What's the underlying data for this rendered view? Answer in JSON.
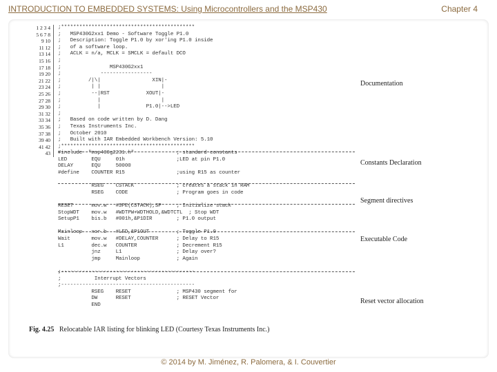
{
  "header": {
    "title": "INTRODUCTION TO EMBEDDED SYSTEMS: Using Microcontrollers and the MSP430",
    "chapter": "Chapter 4"
  },
  "footer": {
    "copyright": "© 2014 by M. Jiménez, R. Palomera, & I. Couvertier"
  },
  "caption": {
    "label": "Fig. 4.25",
    "text": "Relocatable IAR listing for blinking LED (Courtesy Texas Instruments Inc.)"
  },
  "section_labels": {
    "doc": "Documentation",
    "const": "Constants Declaration",
    "seg": "Segment directives",
    "exec": "Executable Code",
    "reset": "Reset vector allocation"
  },
  "listing": {
    "lines": "1\n2\n3\n4\n5\n6\n7\n8\n9\n10\n11\n12\n13\n14\n15\n16\n17\n18\n19\n20\n21\n22\n23\n24\n25\n26\n27\n28\n29\n30\n31\n32\n33\n34\n35\n36\n37\n38\n39\n40\n41\n42\n43",
    "code": ";********************************************\n;   MSP430G2xx1 Demo - Software Toggle P1.0\n;   Description: Toggle P1.0 by xor'ing P1.0 inside\n;   of a software loop.\n;   ACLK = n/a, MCLK = SMCLK = default DCO\n;\n;                MSP430G2xx1\n;             -----------------\n;         /|\\|                 XIN|-\n;          | |                    |\n;          --|RST            XOUT|-\n;            |                    |\n;            |               P1.0|-->LED\n;\n;   Based on code written by D. Dang\n;   Texas Instruments Inc.\n;   October 2010\n;   Built with IAR Embedded Workbench Version: 5.10\n;********************************************\n#include  \"msp430g2231.h\"              ; standard constants\nLED        EQU     01h                 ;LED at pin P1.0\nDELAY      EQU     50000\n#define    COUNTER R15                 ;using R15 as counter\n\n           RSEG    CSTACK              ; creates a stack in RAM\n           RSEG    CODE                ; Program goes in code\n\nRESET      mov.w   #SFE(CSTACK),SP     ; Initialize stack\nStopWDT    mov.w   #WDTPW+WDTHOLD,&WDTCTL  ; Stop WDT\nSetupP1    bis.b   #001h,&P1DIR        ; P1.0 output\n\nMainloop   xor.b   #LED,&P1OUT         ; Toggle P1.0\nWait       mov.w   #DELAY,COUNTER      ; Delay to R15\nL1         dec.w   COUNTER             ; Decrement R15\n           jnz     L1                  ; Delay over?\n           jmp     Mainloop            ; Again\n\n;--------------------------------------------\n;           Interrupt Vectors\n;--------------------------------------------\n           RSEG    RESET               ; MSP430 segment for\n           DW      RESET               ; RESET Vector\n           END"
  }
}
